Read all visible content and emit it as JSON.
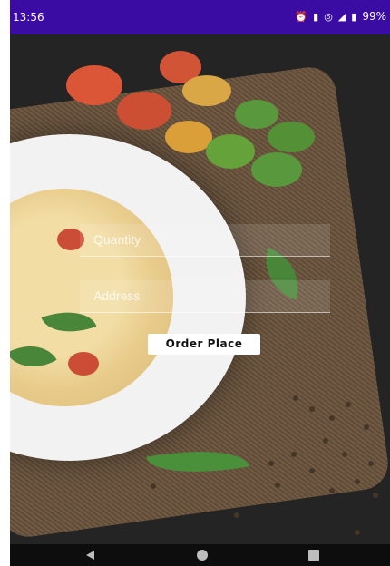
{
  "status_bar": {
    "time": "13:56",
    "battery": "99%"
  },
  "form": {
    "quantity_placeholder": "Quantity",
    "address_placeholder": "Address",
    "order_button_label": "Order Place"
  },
  "nav": {
    "back_icon": "back-triangle-icon",
    "home_icon": "home-circle-icon",
    "recents_icon": "recents-square-icon"
  },
  "colors": {
    "status_bar": "#3a0ca3",
    "button_bg": "#ffffff",
    "button_text": "#111111"
  }
}
